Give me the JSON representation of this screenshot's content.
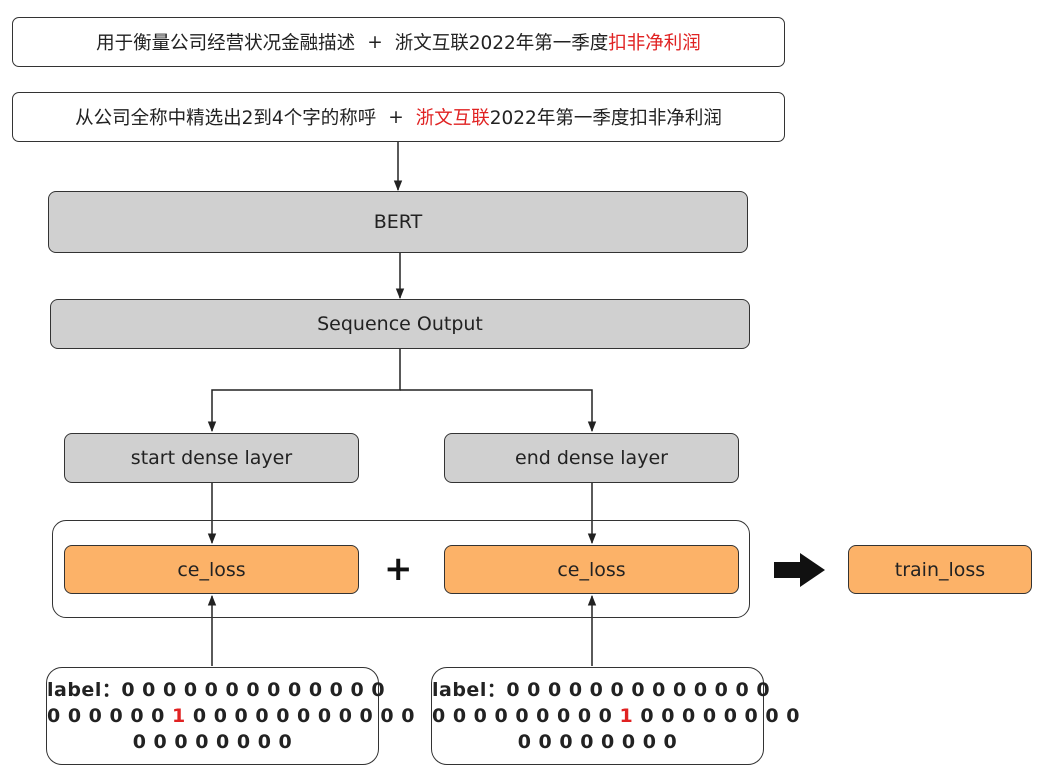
{
  "prompt_top": {
    "before_plus": "用于衡量公司经营状况金融描述",
    "plus": "+",
    "normal": "浙文互联2022年第一季度",
    "highlight": "扣非净利润"
  },
  "prompt_bottom": {
    "before_plus": "从公司全称中精选出2到4个字的称呼",
    "plus": "+",
    "highlight": "浙文互联",
    "normal": "2022年第一季度扣非净利润"
  },
  "bert_label": "BERT",
  "sequence_output_label": "Sequence Output",
  "start_dense_label": "start dense layer",
  "end_dense_label": "end dense layer",
  "ce_loss_left": "ce_loss",
  "ce_loss_right": "ce_loss",
  "plus_sign": "+",
  "train_loss_label": "train_loss",
  "label_left": {
    "line1": "label：0 0 0 0 0 0 0 0 0 0 0 0 0",
    "line2_before": "0 0 0 0 0 0 ",
    "line2_highlight": "1",
    "line2_after": " 0 0 0 0 0 0 0 0 0 0 0",
    "line3": "0 0 0 0 0 0 0 0"
  },
  "label_right": {
    "line1": "label：0 0 0 0 0 0 0 0 0 0 0 0 0",
    "line2_before": "0 0 0 0 0 0 0 0 0 ",
    "line2_highlight": "1",
    "line2_after": " 0 0 0 0 0 0 0 0",
    "line3": "0 0 0 0 0 0 0 0"
  },
  "colors": {
    "highlight_red": "#e02222",
    "gray_box": "#d0d0d0",
    "orange_box": "#fcb268"
  }
}
